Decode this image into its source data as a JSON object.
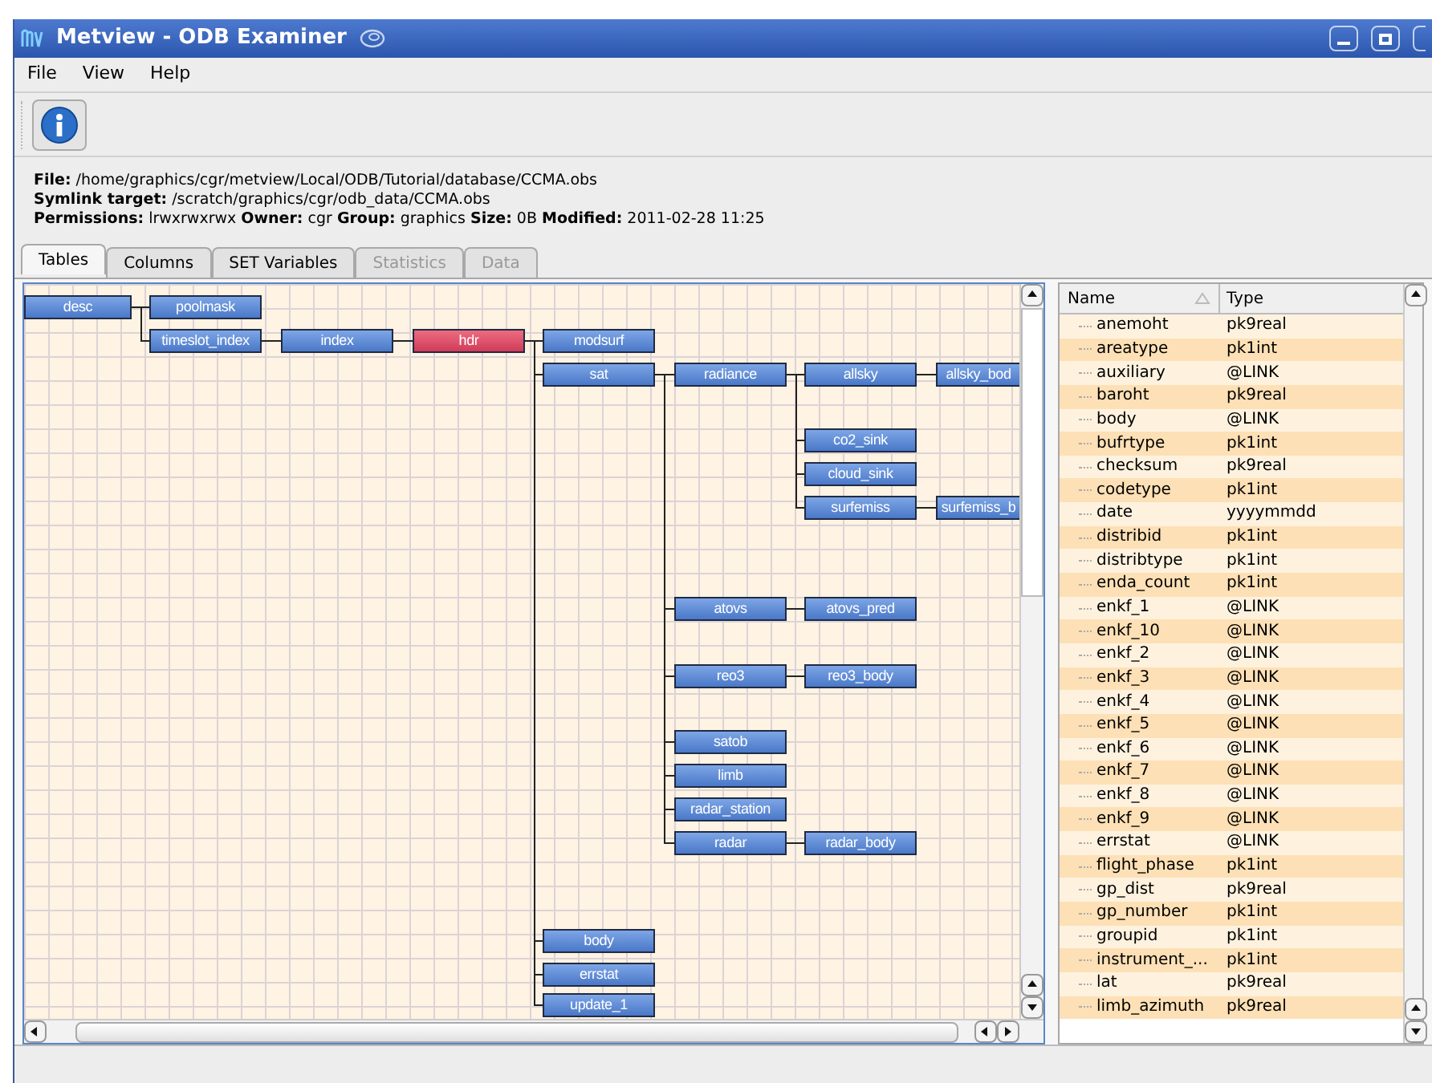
{
  "window": {
    "title": "Metview - ODB Examiner"
  },
  "menu": [
    {
      "label": "File"
    },
    {
      "label": "View"
    },
    {
      "label": "Help"
    }
  ],
  "info": [
    {
      "label": "File:",
      "value": "/home/graphics/cgr/metview/Local/ODB/Tutorial/database/CCMA.obs"
    },
    {
      "label": "Symlink target:",
      "value": "/scratch/graphics/cgr/odb_data/CCMA.obs"
    }
  ],
  "permissions": [
    {
      "label": "Permissions:",
      "value": "lrwxrwxrwx"
    },
    {
      "label": "Owner:",
      "value": "cgr"
    },
    {
      "label": "Group:",
      "value": "graphics"
    },
    {
      "label": "Size:",
      "value": "0B"
    },
    {
      "label": "Modified:",
      "value": "2011-02-28 11:25"
    }
  ],
  "tabs": [
    {
      "label": "Tables",
      "selected": true,
      "disabled": false
    },
    {
      "label": "Columns",
      "selected": false,
      "disabled": false
    },
    {
      "label": "SET Variables",
      "selected": false,
      "disabled": false
    },
    {
      "label": "Statistics",
      "selected": false,
      "disabled": true
    },
    {
      "label": "Data",
      "selected": false,
      "disabled": true
    }
  ],
  "tree": {
    "label": "desc",
    "selected": false,
    "children": [
      {
        "label": "poolmask",
        "selected": false
      },
      {
        "label": "timeslot_index",
        "selected": false,
        "children": [
          {
            "label": "index",
            "selected": false,
            "children": [
              {
                "label": "hdr",
                "selected": true,
                "children": [
                  {
                    "label": "modsurf",
                    "selected": false
                  },
                  {
                    "label": "sat",
                    "selected": false,
                    "children": [
                      {
                        "label": "radiance",
                        "selected": false,
                        "children": [
                          {
                            "label": "allsky",
                            "selected": false,
                            "children": [
                              {
                                "label": "allsky_bod",
                                "selected": false
                              }
                            ]
                          },
                          {
                            "label": "co2_sink",
                            "selected": false
                          },
                          {
                            "label": "cloud_sink",
                            "selected": false
                          },
                          {
                            "label": "surfemiss",
                            "selected": false,
                            "children": [
                              {
                                "label": "surfemiss_b",
                                "selected": false
                              }
                            ]
                          }
                        ]
                      },
                      {
                        "label": "atovs",
                        "selected": false,
                        "children": [
                          {
                            "label": "atovs_pred",
                            "selected": false
                          }
                        ]
                      },
                      {
                        "label": "reo3",
                        "selected": false,
                        "children": [
                          {
                            "label": "reo3_body",
                            "selected": false
                          }
                        ]
                      },
                      {
                        "label": "satob",
                        "selected": false
                      },
                      {
                        "label": "limb",
                        "selected": false
                      },
                      {
                        "label": "radar_station",
                        "selected": false
                      },
                      {
                        "label": "radar",
                        "selected": false,
                        "children": [
                          {
                            "label": "radar_body",
                            "selected": false
                          }
                        ]
                      }
                    ]
                  },
                  {
                    "label": "body",
                    "selected": false
                  },
                  {
                    "label": "errstat",
                    "selected": false
                  },
                  {
                    "label": "update_1",
                    "selected": false
                  }
                ]
              }
            ]
          }
        ]
      }
    ]
  },
  "columns_table": {
    "columns": [
      {
        "label": "Name"
      },
      {
        "label": "Type"
      }
    ],
    "rows": [
      {
        "name": "anemoht",
        "type": "pk9real"
      },
      {
        "name": "areatype",
        "type": "pk1int"
      },
      {
        "name": "auxiliary",
        "type": "@LINK"
      },
      {
        "name": "baroht",
        "type": "pk9real"
      },
      {
        "name": "body",
        "type": "@LINK"
      },
      {
        "name": "bufrtype",
        "type": "pk1int"
      },
      {
        "name": "checksum",
        "type": "pk9real"
      },
      {
        "name": "codetype",
        "type": "pk1int"
      },
      {
        "name": "date",
        "type": "yyyymmdd"
      },
      {
        "name": "distribid",
        "type": "pk1int"
      },
      {
        "name": "distribtype",
        "type": "pk1int"
      },
      {
        "name": "enda_count",
        "type": "pk1int"
      },
      {
        "name": "enkf_1",
        "type": "@LINK"
      },
      {
        "name": "enkf_10",
        "type": "@LINK"
      },
      {
        "name": "enkf_2",
        "type": "@LINK"
      },
      {
        "name": "enkf_3",
        "type": "@LINK"
      },
      {
        "name": "enkf_4",
        "type": "@LINK"
      },
      {
        "name": "enkf_5",
        "type": "@LINK"
      },
      {
        "name": "enkf_6",
        "type": "@LINK"
      },
      {
        "name": "enkf_7",
        "type": "@LINK"
      },
      {
        "name": "enkf_8",
        "type": "@LINK"
      },
      {
        "name": "enkf_9",
        "type": "@LINK"
      },
      {
        "name": "errstat",
        "type": "@LINK"
      },
      {
        "name": "flight_phase",
        "type": "pk1int"
      },
      {
        "name": "gp_dist",
        "type": "pk9real"
      },
      {
        "name": "gp_number",
        "type": "pk1int"
      },
      {
        "name": "groupid",
        "type": "pk1int"
      },
      {
        "name": "instrument_...",
        "type": "pk1int"
      },
      {
        "name": "lat",
        "type": "pk9real"
      },
      {
        "name": "limb_azimuth",
        "type": "pk9real"
      }
    ]
  }
}
